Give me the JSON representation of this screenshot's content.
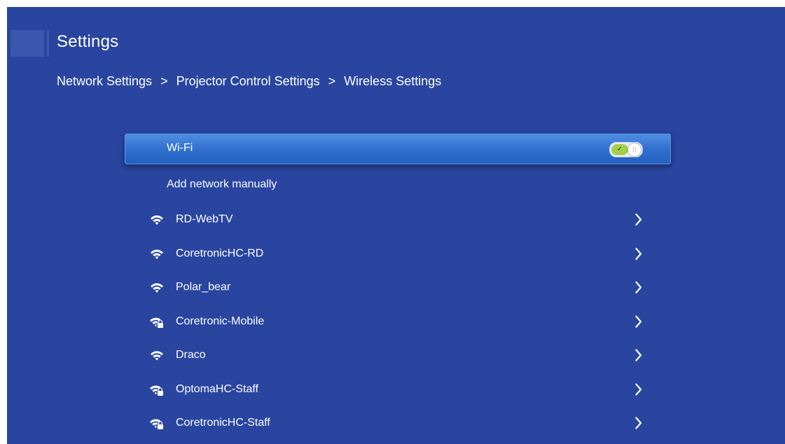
{
  "header": {
    "title": "Settings"
  },
  "breadcrumb": {
    "items": [
      "Network Settings",
      "Projector Control Settings",
      "Wireless Settings"
    ],
    "separator": ">"
  },
  "wifi": {
    "label": "Wi-Fi",
    "toggle_state": "on",
    "toggle_check": "✓"
  },
  "add_network": {
    "label": "Add network manually"
  },
  "networks": [
    {
      "name": "RD-WebTV",
      "secured": false,
      "icon": "wifi-icon"
    },
    {
      "name": "CoretronicHC-RD",
      "secured": false,
      "icon": "wifi-icon"
    },
    {
      "name": "Polar_bear",
      "secured": false,
      "icon": "wifi-icon"
    },
    {
      "name": "Coretronic-Mobile",
      "secured": true,
      "icon": "wifi-lock-icon"
    },
    {
      "name": "Draco",
      "secured": false,
      "icon": "wifi-icon"
    },
    {
      "name": "OptomaHC-Staff",
      "secured": true,
      "icon": "wifi-lock-icon"
    },
    {
      "name": "CoretronicHC-Staff",
      "secured": true,
      "icon": "wifi-lock-icon"
    }
  ],
  "colors": {
    "background": "#2945a0",
    "highlight": "#2f6fcd",
    "toggle_on": "#a5cf4a",
    "text": "#ffffff"
  }
}
